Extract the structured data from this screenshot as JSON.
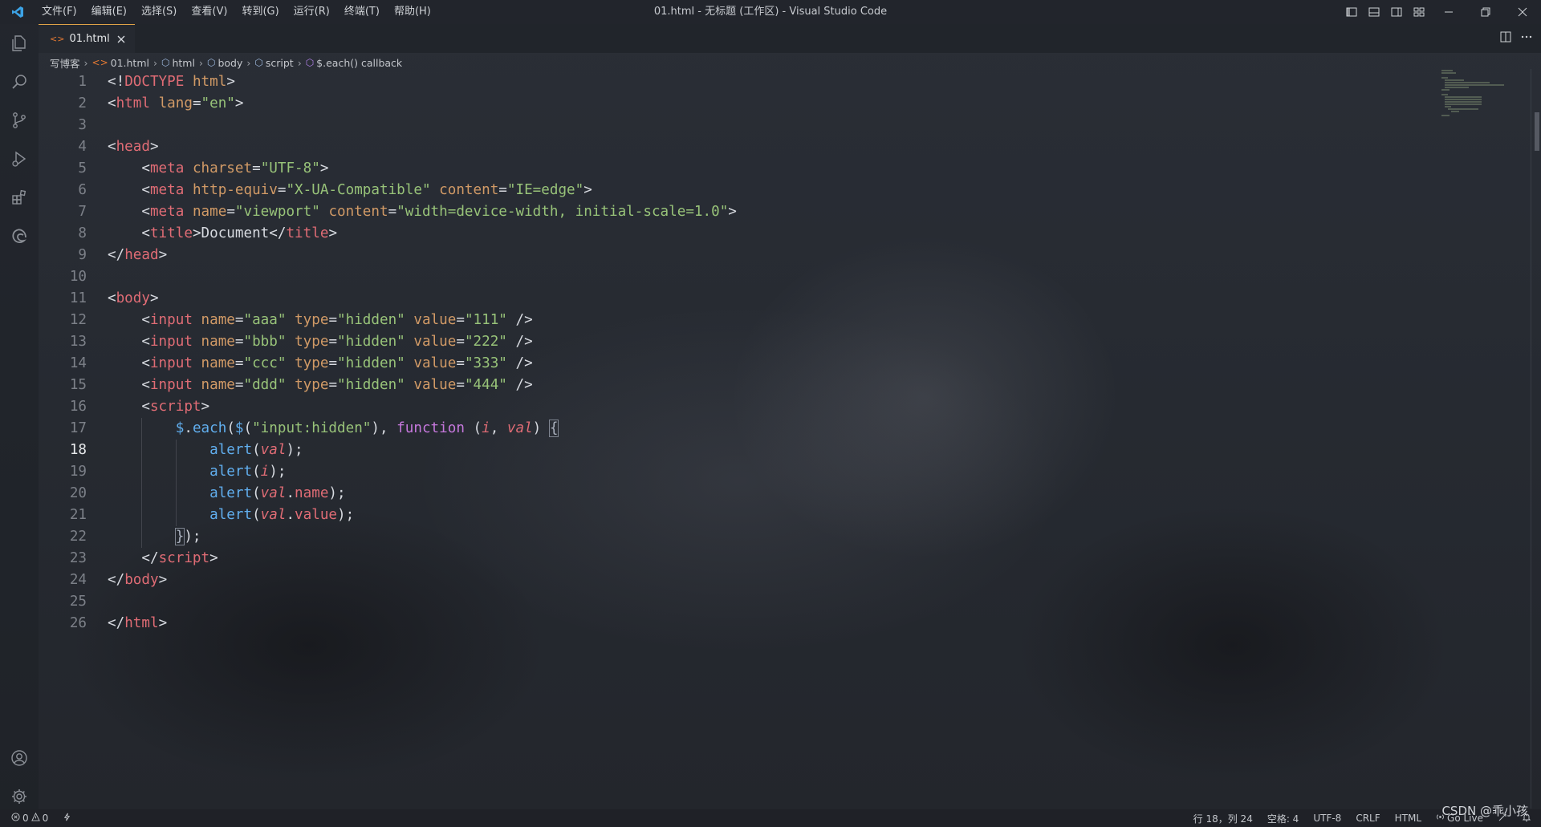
{
  "window": {
    "title": "01.html - 无标题 (工作区) - Visual Studio Code",
    "menus": [
      "文件(F)",
      "编辑(E)",
      "选择(S)",
      "查看(V)",
      "转到(G)",
      "运行(R)",
      "终端(T)",
      "帮助(H)"
    ]
  },
  "tab": {
    "label": "01.html",
    "icon_glyph": "<>"
  },
  "breadcrumb": [
    {
      "label": "写博客",
      "icon": ""
    },
    {
      "label": "01.html",
      "icon": "<>"
    },
    {
      "label": "html",
      "icon": "⬡"
    },
    {
      "label": "body",
      "icon": "⬡"
    },
    {
      "label": "script",
      "icon": "⬡"
    },
    {
      "label": "$.each() callback",
      "icon": "⬡"
    }
  ],
  "editor": {
    "active_line": 18,
    "lines": [
      [
        [
          "p",
          "<!"
        ],
        [
          "k",
          "DOCTYPE"
        ],
        [
          "x",
          " "
        ],
        [
          "a",
          "html"
        ],
        [
          "p",
          ">"
        ]
      ],
      [
        [
          "p",
          "<"
        ],
        [
          "t",
          "html"
        ],
        [
          "x",
          " "
        ],
        [
          "a",
          "lang"
        ],
        [
          "p",
          "="
        ],
        [
          "s",
          "\"en\""
        ],
        [
          "p",
          ">"
        ]
      ],
      [],
      [
        [
          "p",
          "<"
        ],
        [
          "t",
          "head"
        ],
        [
          "p",
          ">"
        ]
      ],
      [
        [
          "x",
          "    "
        ],
        [
          "p",
          "<"
        ],
        [
          "t",
          "meta"
        ],
        [
          "x",
          " "
        ],
        [
          "a",
          "charset"
        ],
        [
          "p",
          "="
        ],
        [
          "s",
          "\"UTF-8\""
        ],
        [
          "p",
          ">"
        ]
      ],
      [
        [
          "x",
          "    "
        ],
        [
          "p",
          "<"
        ],
        [
          "t",
          "meta"
        ],
        [
          "x",
          " "
        ],
        [
          "a",
          "http-equiv"
        ],
        [
          "p",
          "="
        ],
        [
          "s",
          "\"X-UA-Compatible\""
        ],
        [
          "x",
          " "
        ],
        [
          "a",
          "content"
        ],
        [
          "p",
          "="
        ],
        [
          "s",
          "\"IE=edge\""
        ],
        [
          "p",
          ">"
        ]
      ],
      [
        [
          "x",
          "    "
        ],
        [
          "p",
          "<"
        ],
        [
          "t",
          "meta"
        ],
        [
          "x",
          " "
        ],
        [
          "a",
          "name"
        ],
        [
          "p",
          "="
        ],
        [
          "s",
          "\"viewport\""
        ],
        [
          "x",
          " "
        ],
        [
          "a",
          "content"
        ],
        [
          "p",
          "="
        ],
        [
          "s",
          "\"width=device-width, initial-scale=1.0\""
        ],
        [
          "p",
          ">"
        ]
      ],
      [
        [
          "x",
          "    "
        ],
        [
          "p",
          "<"
        ],
        [
          "t",
          "title"
        ],
        [
          "p",
          ">"
        ],
        [
          "x",
          "Document"
        ],
        [
          "p",
          "</"
        ],
        [
          "t",
          "title"
        ],
        [
          "p",
          ">"
        ]
      ],
      [
        [
          "p",
          "</"
        ],
        [
          "t",
          "head"
        ],
        [
          "p",
          ">"
        ]
      ],
      [],
      [
        [
          "p",
          "<"
        ],
        [
          "t",
          "body"
        ],
        [
          "p",
          ">"
        ]
      ],
      [
        [
          "x",
          "    "
        ],
        [
          "p",
          "<"
        ],
        [
          "t",
          "input"
        ],
        [
          "x",
          " "
        ],
        [
          "a",
          "name"
        ],
        [
          "p",
          "="
        ],
        [
          "s",
          "\"aaa\""
        ],
        [
          "x",
          " "
        ],
        [
          "a",
          "type"
        ],
        [
          "p",
          "="
        ],
        [
          "s",
          "\"hidden\""
        ],
        [
          "x",
          " "
        ],
        [
          "a",
          "value"
        ],
        [
          "p",
          "="
        ],
        [
          "s",
          "\"111\""
        ],
        [
          "x",
          " "
        ],
        [
          "p",
          "/>"
        ]
      ],
      [
        [
          "x",
          "    "
        ],
        [
          "p",
          "<"
        ],
        [
          "t",
          "input"
        ],
        [
          "x",
          " "
        ],
        [
          "a",
          "name"
        ],
        [
          "p",
          "="
        ],
        [
          "s",
          "\"bbb\""
        ],
        [
          "x",
          " "
        ],
        [
          "a",
          "type"
        ],
        [
          "p",
          "="
        ],
        [
          "s",
          "\"hidden\""
        ],
        [
          "x",
          " "
        ],
        [
          "a",
          "value"
        ],
        [
          "p",
          "="
        ],
        [
          "s",
          "\"222\""
        ],
        [
          "x",
          " "
        ],
        [
          "p",
          "/>"
        ]
      ],
      [
        [
          "x",
          "    "
        ],
        [
          "p",
          "<"
        ],
        [
          "t",
          "input"
        ],
        [
          "x",
          " "
        ],
        [
          "a",
          "name"
        ],
        [
          "p",
          "="
        ],
        [
          "s",
          "\"ccc\""
        ],
        [
          "x",
          " "
        ],
        [
          "a",
          "type"
        ],
        [
          "p",
          "="
        ],
        [
          "s",
          "\"hidden\""
        ],
        [
          "x",
          " "
        ],
        [
          "a",
          "value"
        ],
        [
          "p",
          "="
        ],
        [
          "s",
          "\"333\""
        ],
        [
          "x",
          " "
        ],
        [
          "p",
          "/>"
        ]
      ],
      [
        [
          "x",
          "    "
        ],
        [
          "p",
          "<"
        ],
        [
          "t",
          "input"
        ],
        [
          "x",
          " "
        ],
        [
          "a",
          "name"
        ],
        [
          "p",
          "="
        ],
        [
          "s",
          "\"ddd\""
        ],
        [
          "x",
          " "
        ],
        [
          "a",
          "type"
        ],
        [
          "p",
          "="
        ],
        [
          "s",
          "\"hidden\""
        ],
        [
          "x",
          " "
        ],
        [
          "a",
          "value"
        ],
        [
          "p",
          "="
        ],
        [
          "s",
          "\"444\""
        ],
        [
          "x",
          " "
        ],
        [
          "p",
          "/>"
        ]
      ],
      [
        [
          "x",
          "    "
        ],
        [
          "p",
          "<"
        ],
        [
          "t",
          "script"
        ],
        [
          "p",
          ">"
        ]
      ],
      [
        [
          "x",
          "        "
        ],
        [
          "f",
          "$"
        ],
        [
          "p",
          "."
        ],
        [
          "f",
          "each"
        ],
        [
          "p",
          "("
        ],
        [
          "f",
          "$"
        ],
        [
          "p",
          "("
        ],
        [
          "s",
          "\"input:hidden\""
        ],
        [
          "p",
          "), "
        ],
        [
          "k",
          "function"
        ],
        [
          "x",
          " "
        ],
        [
          "p",
          "("
        ],
        [
          "v",
          "i"
        ],
        [
          "p",
          ", "
        ],
        [
          "v",
          "val"
        ],
        [
          "p",
          ") "
        ],
        [
          "b",
          "{"
        ]
      ],
      [
        [
          "x",
          "            "
        ],
        [
          "f",
          "alert"
        ],
        [
          "p",
          "("
        ],
        [
          "v",
          "val"
        ],
        [
          "p",
          ");"
        ]
      ],
      [
        [
          "x",
          "            "
        ],
        [
          "f",
          "alert"
        ],
        [
          "p",
          "("
        ],
        [
          "v",
          "i"
        ],
        [
          "p",
          ");"
        ]
      ],
      [
        [
          "x",
          "            "
        ],
        [
          "f",
          "alert"
        ],
        [
          "p",
          "("
        ],
        [
          "v",
          "val"
        ],
        [
          "p",
          "."
        ],
        [
          "r",
          "name"
        ],
        [
          "p",
          ");"
        ]
      ],
      [
        [
          "x",
          "            "
        ],
        [
          "f",
          "alert"
        ],
        [
          "p",
          "("
        ],
        [
          "v",
          "val"
        ],
        [
          "p",
          "."
        ],
        [
          "r",
          "value"
        ],
        [
          "p",
          ");"
        ]
      ],
      [
        [
          "x",
          "        "
        ],
        [
          "b",
          "}"
        ],
        [
          "p",
          ");"
        ]
      ],
      [
        [
          "x",
          "    "
        ],
        [
          "p",
          "</"
        ],
        [
          "t",
          "script"
        ],
        [
          "p",
          ">"
        ]
      ],
      [
        [
          "p",
          "</"
        ],
        [
          "t",
          "body"
        ],
        [
          "p",
          ">"
        ]
      ],
      [],
      [
        [
          "p",
          "</"
        ],
        [
          "t",
          "html"
        ],
        [
          "p",
          ">"
        ]
      ]
    ]
  },
  "statusbar": {
    "errors": "0",
    "warnings": "0",
    "position": "行 18，列 24",
    "spaces": "空格: 4",
    "encoding": "UTF-8",
    "eol": "CRLF",
    "language": "HTML",
    "golive": "Go Live"
  },
  "watermark": "CSDN @乖小孩",
  "icons": {
    "activity": [
      "explorer-icon",
      "search-icon",
      "source-control-icon",
      "run-debug-icon",
      "extensions-icon",
      "edge-devtools-icon",
      "account-icon",
      "settings-gear-icon"
    ]
  }
}
